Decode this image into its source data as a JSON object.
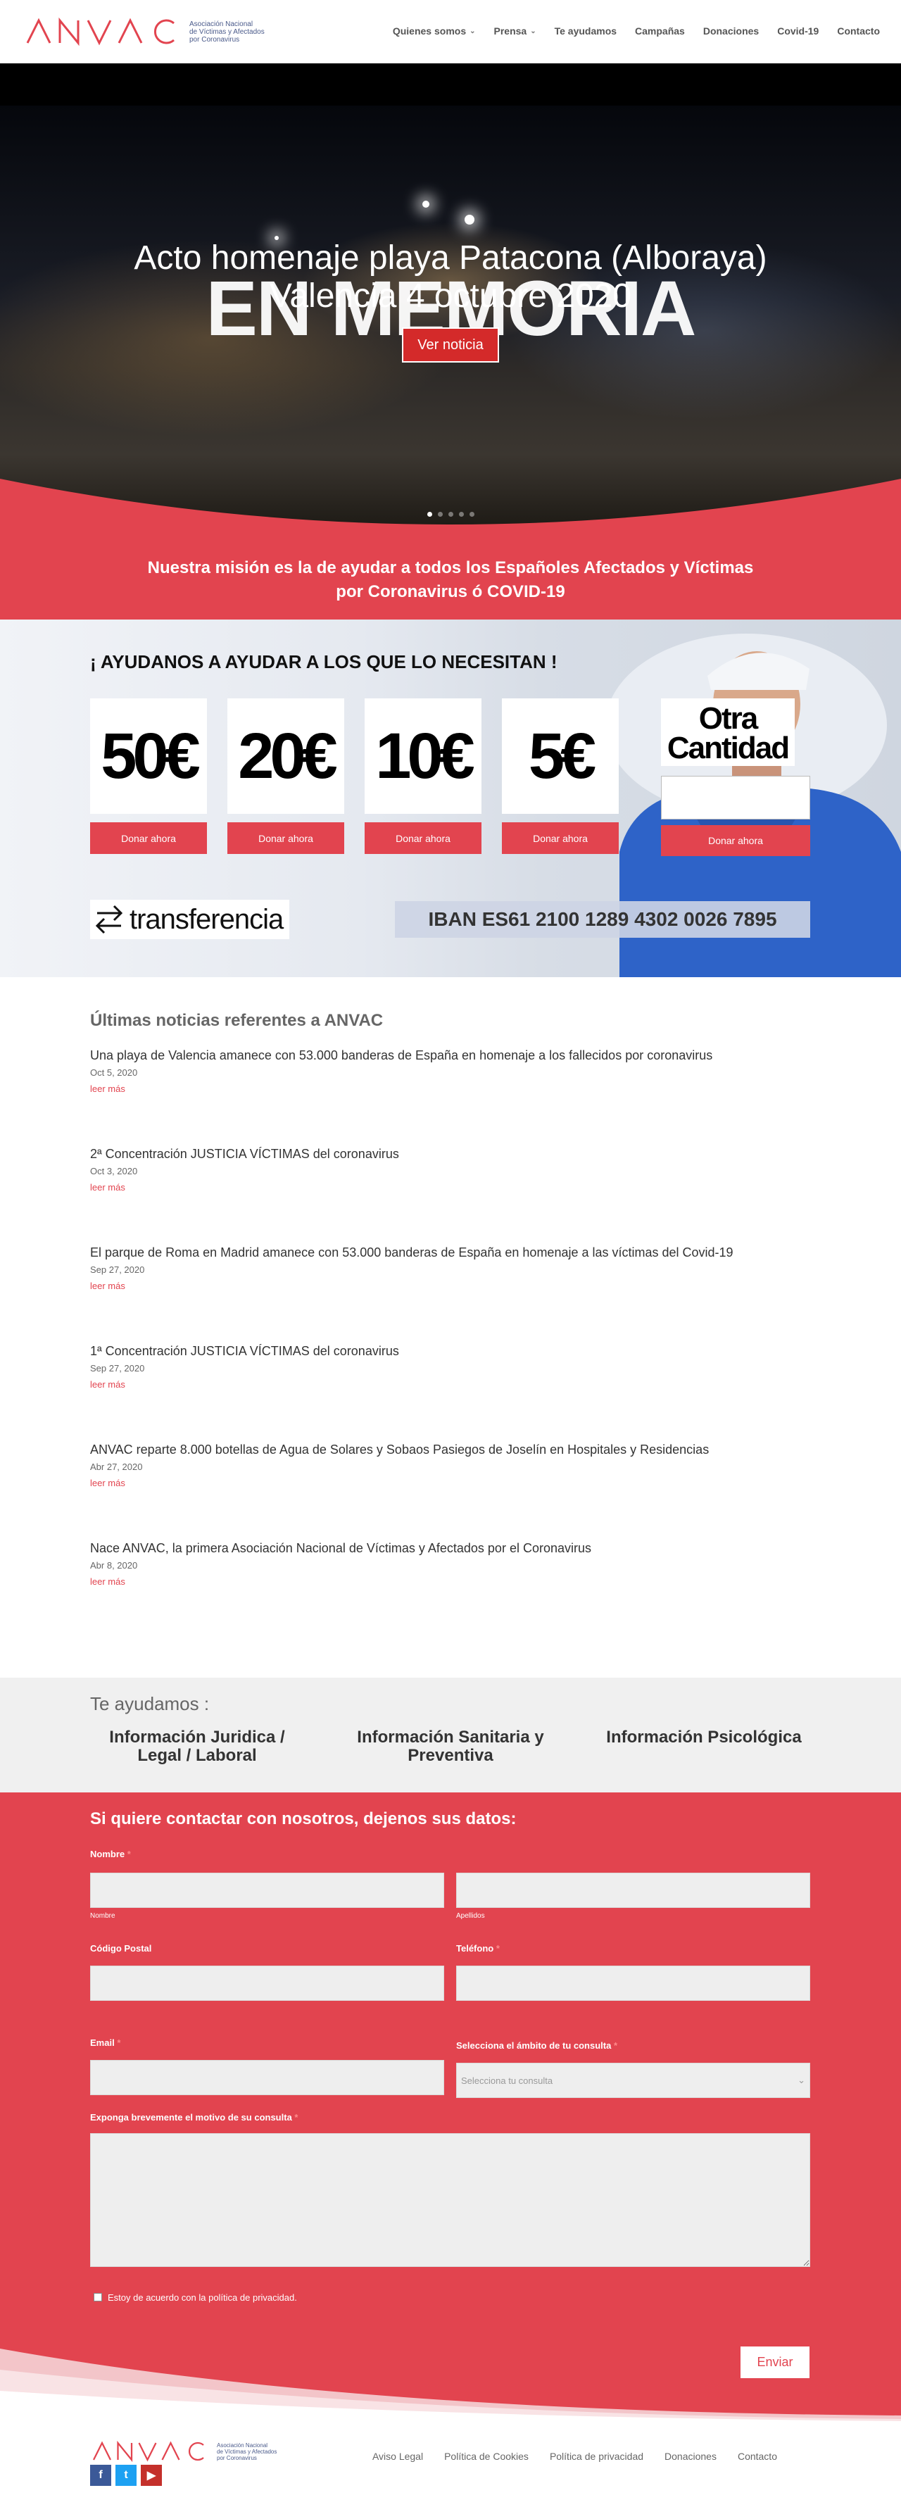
{
  "brand": {
    "logo_letters": "ANVAC",
    "logo_lines": [
      "Asociación Nacional",
      "de Víctimas y Afectados",
      "por Coronavirus"
    ]
  },
  "nav": [
    {
      "label": "Quienes somos",
      "dropdown": true
    },
    {
      "label": "Prensa",
      "dropdown": true
    },
    {
      "label": "Te ayudamos",
      "dropdown": false
    },
    {
      "label": "Campañas",
      "dropdown": false
    },
    {
      "label": "Donaciones",
      "dropdown": false
    },
    {
      "label": "Covid-19",
      "dropdown": false
    },
    {
      "label": "Contacto",
      "dropdown": false
    }
  ],
  "hero": {
    "background_text": "EN MEMORIA",
    "title": "Acto homenaje playa Patacona (Alboraya) Valencia 4 octubre 2020",
    "button": "Ver noticia",
    "slides": 5,
    "active_slide": 1
  },
  "mission": "Nuestra misión es la de ayudar a todos los Españoles Afectados y Víctimas por Coronavirus ó COVID-19",
  "donate": {
    "heading": "¡ AYUDANOS A AYUDAR A LOS QUE LO NECESITAN !",
    "amounts": [
      "50€",
      "20€",
      "10€",
      "5€"
    ],
    "button": "Donar ahora",
    "other_amount": "Otra Cantidad",
    "transfer": "transferencia",
    "iban": "IBAN ES61 2100 1289 4302 0026 7895"
  },
  "news": {
    "heading": "Últimas noticias referentes a ANVAC",
    "more": "leer más",
    "items": [
      {
        "title": "Una playa de Valencia amanece con 53.000 banderas de España en homenaje a los fallecidos por coronavirus",
        "date": "Oct 5, 2020"
      },
      {
        "title": "2ª Concentración JUSTICIA VÍCTIMAS del coronavirus",
        "date": "Oct 3, 2020"
      },
      {
        "title": "El parque de Roma en Madrid amanece con 53.000 banderas de España en homenaje a las víctimas del Covid-19",
        "date": "Sep 27, 2020"
      },
      {
        "title": "1ª Concentración JUSTICIA VÍCTIMAS del coronavirus",
        "date": "Sep 27, 2020"
      },
      {
        "title": "ANVAC reparte 8.000 botellas de Agua de Solares y Sobaos Pasiegos de Joselín en Hospitales y Residencias",
        "date": "Abr 27, 2020"
      },
      {
        "title": "Nace ANVAC, la primera Asociación Nacional de Víctimas y Afectados por el Coronavirus",
        "date": "Abr 8, 2020"
      }
    ]
  },
  "help": {
    "heading": "Te ayudamos :",
    "columns": [
      "Información Juridica / Legal / Laboral",
      "Información Sanitaria y Preventiva",
      "Información Psicológica"
    ]
  },
  "contact": {
    "heading": "Si quiere contactar con nosotros, dejenos sus datos:",
    "name_label": "Nombre",
    "first_name_sub": "Nombre",
    "last_name_sub": "Apellidos",
    "postal_label": "Código Postal",
    "phone_label": "Teléfono",
    "email_label": "Email",
    "scope_label": "Selecciona el ámbito de tu consulta",
    "scope_placeholder": "Selecciona tu consulta",
    "message_label": "Exponga brevemente el motivo de su consulta",
    "required_mark": "*",
    "privacy": "Estoy de acuerdo con la política de privacidad.",
    "submit": "Enviar"
  },
  "footer": {
    "social": [
      "f",
      "t",
      "▶"
    ],
    "social_colors": [
      "#3b5998",
      "#1da1f2",
      "#c4302b"
    ],
    "links": [
      "Aviso Legal",
      "Política de Cookies",
      "Política de privacidad",
      "Donaciones",
      "Contacto"
    ]
  },
  "colors": {
    "accent": "#e2444f",
    "button_red": "#d42a2a"
  }
}
